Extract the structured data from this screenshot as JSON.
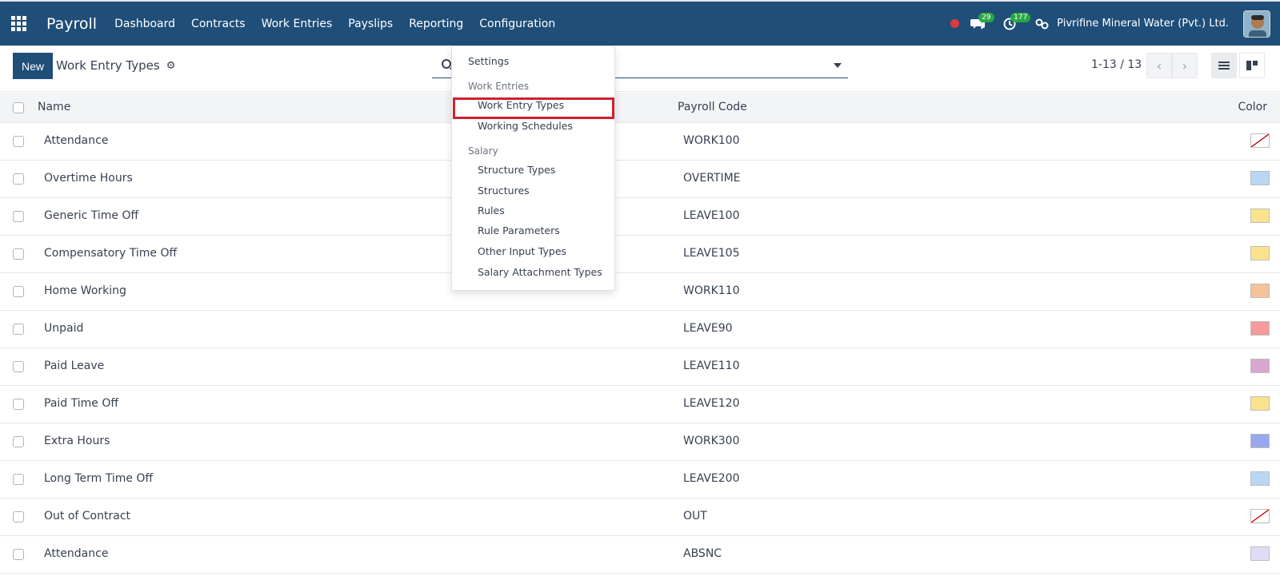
{
  "app": {
    "name": "Payroll",
    "nav": [
      "Dashboard",
      "Contracts",
      "Work Entries",
      "Payslips",
      "Reporting",
      "Configuration"
    ],
    "messages_count": "29",
    "activities_count": "177",
    "company": "Pivrifine Mineral Water (Pvt.) Ltd."
  },
  "control_panel": {
    "new_label": "New",
    "title": "Work Entry Types",
    "pager": "1-13 / 13"
  },
  "table": {
    "headers": {
      "name": "Name",
      "code": "Payroll Code",
      "color": "Color"
    },
    "rows": [
      {
        "name": "Attendance",
        "code": "WORK100",
        "color": "none"
      },
      {
        "name": "Overtime Hours",
        "code": "OVERTIME",
        "color": "#b9d7f5"
      },
      {
        "name": "Generic Time Off",
        "code": "LEAVE100",
        "color": "#fbe28c"
      },
      {
        "name": "Compensatory Time Off",
        "code": "LEAVE105",
        "color": "#fbe28c"
      },
      {
        "name": "Home Working",
        "code": "WORK110",
        "color": "#f5c29a"
      },
      {
        "name": "Unpaid",
        "code": "LEAVE90",
        "color": "#f49a9a"
      },
      {
        "name": "Paid Leave",
        "code": "LEAVE110",
        "color": "#d9a6cf"
      },
      {
        "name": "Paid Time Off",
        "code": "LEAVE120",
        "color": "#fbe28c"
      },
      {
        "name": "Extra Hours",
        "code": "WORK300",
        "color": "#98a8ee"
      },
      {
        "name": "Long Term Time Off",
        "code": "LEAVE200",
        "color": "#b9d7f5"
      },
      {
        "name": "Out of Contract",
        "code": "OUT",
        "color": "none"
      },
      {
        "name": "Attendance",
        "code": "ABSNC",
        "color": "#e2dcf7"
      }
    ]
  },
  "config_menu": {
    "settings": "Settings",
    "work_entries_header": "Work Entries",
    "work_entry_types": "Work Entry Types",
    "working_schedules": "Working Schedules",
    "salary_header": "Salary",
    "structure_types": "Structure Types",
    "structures": "Structures",
    "rules": "Rules",
    "rule_parameters": "Rule Parameters",
    "other_input_types": "Other Input Types",
    "salary_attachment_types": "Salary Attachment Types"
  }
}
